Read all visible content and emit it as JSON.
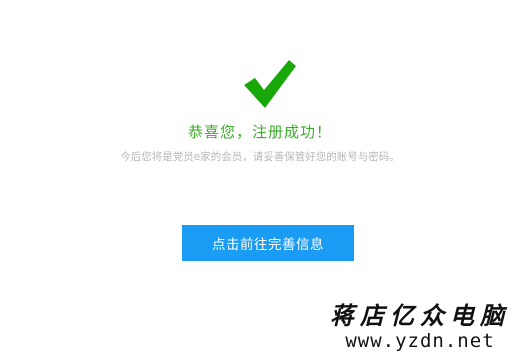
{
  "success": {
    "icon": "checkmark-icon",
    "icon_color": "#18a80a",
    "title": "恭喜您，注册成功！",
    "title_color": "#3cac2b",
    "note": "今后您将是党员e家的会员，请妥善保管好您的账号与密码。",
    "note_color": "#b8b8b8"
  },
  "actions": {
    "complete_info_label": "点击前往完善信息",
    "button_color": "#1a9cf5"
  },
  "watermark": {
    "brand": "蒋店亿众电脑",
    "url": "www.yzdn.net"
  }
}
